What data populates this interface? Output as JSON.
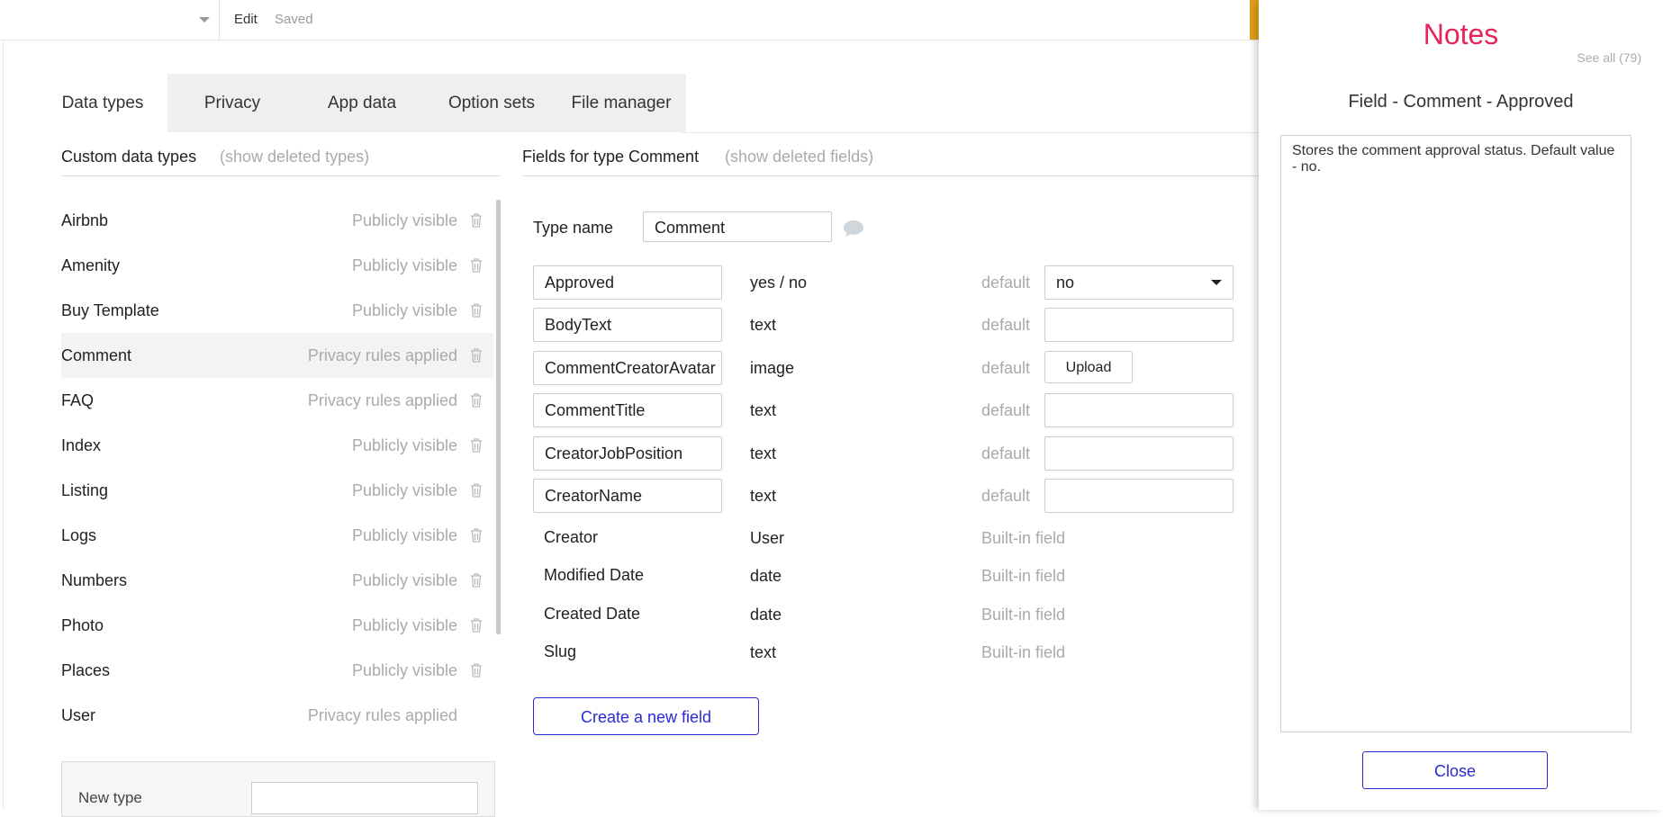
{
  "topbar": {
    "edit": "Edit",
    "status": "Saved"
  },
  "tabs": [
    {
      "label": "Data types"
    },
    {
      "label": "Privacy"
    },
    {
      "label": "App data"
    },
    {
      "label": "Option sets"
    },
    {
      "label": "File manager"
    }
  ],
  "types_section": {
    "title": "Custom data types",
    "link": "(show deleted types)"
  },
  "types": [
    {
      "name": "Airbnb",
      "visibility": "Publicly visible"
    },
    {
      "name": "Amenity",
      "visibility": "Publicly visible"
    },
    {
      "name": "Buy Template",
      "visibility": "Publicly visible"
    },
    {
      "name": "Comment",
      "visibility": "Privacy rules applied"
    },
    {
      "name": "FAQ",
      "visibility": "Privacy rules applied"
    },
    {
      "name": "Index",
      "visibility": "Publicly visible"
    },
    {
      "name": "Listing",
      "visibility": "Publicly visible"
    },
    {
      "name": "Logs",
      "visibility": "Publicly visible"
    },
    {
      "name": "Numbers",
      "visibility": "Publicly visible"
    },
    {
      "name": "Photo",
      "visibility": "Publicly visible"
    },
    {
      "name": "Places",
      "visibility": "Publicly visible"
    },
    {
      "name": "User",
      "visibility": "Privacy rules applied"
    }
  ],
  "new_type": {
    "label": "New type"
  },
  "fields_section": {
    "title": "Fields for type Comment",
    "link": "(show deleted fields)"
  },
  "type_name": {
    "label": "Type name",
    "value": "Comment"
  },
  "fields": [
    {
      "name": "Approved",
      "type": "yes / no",
      "default_label": "default",
      "default_value": "no"
    },
    {
      "name": "BodyText",
      "type": "text",
      "default_label": "default",
      "default_value": ""
    },
    {
      "name": "CommentCreatorAvatar",
      "type": "image",
      "default_label": "default",
      "upload_label": "Upload"
    },
    {
      "name": "CommentTitle",
      "type": "text",
      "default_label": "default",
      "default_value": ""
    },
    {
      "name": "CreatorJobPosition",
      "type": "text",
      "default_label": "default",
      "default_value": ""
    },
    {
      "name": "CreatorName",
      "type": "text",
      "default_label": "default",
      "default_value": ""
    }
  ],
  "builtin_fields": [
    {
      "name": "Creator",
      "type": "User",
      "note": "Built-in field"
    },
    {
      "name": "Modified Date",
      "type": "date",
      "note": "Built-in field"
    },
    {
      "name": "Created Date",
      "type": "date",
      "note": "Built-in field"
    },
    {
      "name": "Slug",
      "type": "text",
      "note": "Built-in field"
    }
  ],
  "create_field": "Create a new field",
  "notes": {
    "title": "Notes",
    "see_all": "See all (79)",
    "field_title": "Field - Comment - Approved",
    "text": "Stores the comment approval status. Default value - no.",
    "close": "Close"
  },
  "colors": {
    "accent": "#2a2ad8",
    "notes_title": "#e8245c",
    "orange": "#e1a11a"
  }
}
